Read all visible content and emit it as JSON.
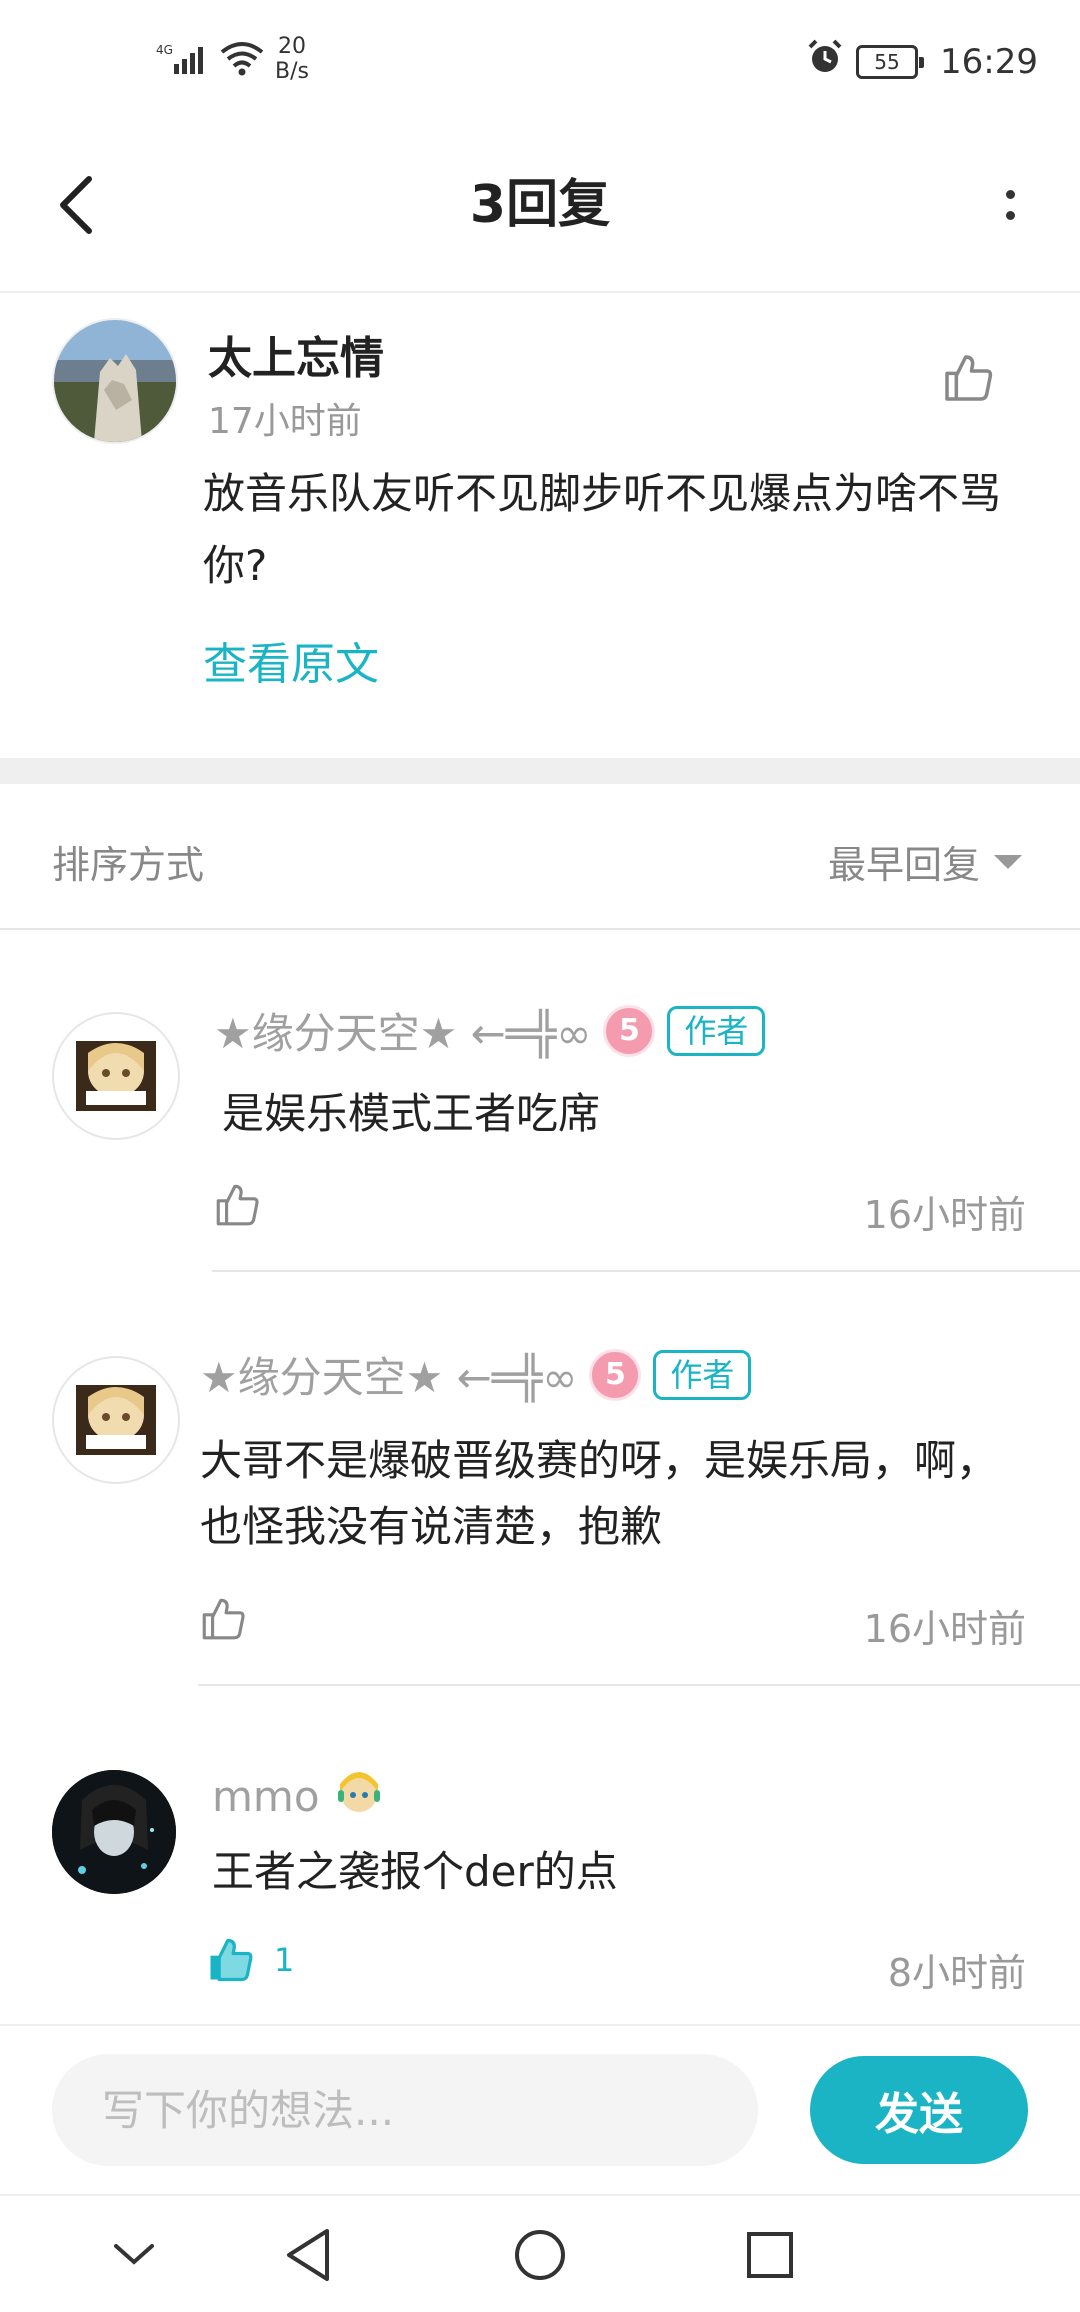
{
  "status_bar": {
    "network": "4G",
    "speed_value": "20",
    "speed_unit": "B/s",
    "battery": "55",
    "time": "16:29"
  },
  "header": {
    "title": "3回复"
  },
  "post": {
    "author": "太上忘情",
    "time": "17小时前",
    "text": "放音乐队友听不见脚步听不见爆点为啥不骂你?",
    "view_original": "查看原文"
  },
  "sort": {
    "label": "排序方式",
    "value": "最早回复"
  },
  "replies": [
    {
      "name": "★缘分天空★ ←═╬∞",
      "level": "5",
      "tag": "作者",
      "text": "是娱乐模式王者吃席",
      "time": "16小时前"
    },
    {
      "name": "★缘分天空★ ←═╬∞",
      "level": "5",
      "tag": "作者",
      "text": "大哥不是爆破晋级赛的呀，是娱乐局，啊，也怪我没有说清楚，抱歉",
      "time": "16小时前"
    },
    {
      "name": "mmo",
      "text": "王者之袭报个der的点",
      "likes": "1",
      "time": "8小时前"
    }
  ],
  "input": {
    "placeholder": "写下你的想法..."
  },
  "send_label": "发送",
  "colors": {
    "accent": "#1ab4c4",
    "level_badge": "#f59bb0"
  }
}
